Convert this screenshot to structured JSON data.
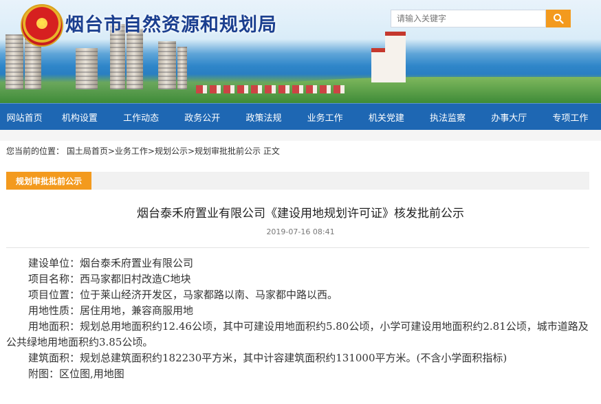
{
  "header": {
    "site_title": "烟台市自然资源和规划局",
    "search_placeholder": "请输入关键字",
    "emblem_icon": "national-emblem-icon",
    "search_icon": "search-icon",
    "accent_color": "#f39a1e",
    "nav_color": "#1e67b3"
  },
  "nav": {
    "items": [
      "网站首页",
      "机构设置",
      "工作动态",
      "政务公开",
      "政策法规",
      "业务工作",
      "机关党建",
      "执法监察",
      "办事大厅",
      "专项工作"
    ]
  },
  "breadcrumb": {
    "prefix": "您当前的位置：",
    "path": "国土局首页>业务工作>规划公示>规划审批批前公示   正文"
  },
  "section": {
    "label": "规划审批批前公示"
  },
  "article": {
    "title": "烟台泰禾府置业有限公司《建设用地规划许可证》核发批前公示",
    "date": "2019-07-16 08:41",
    "paragraphs": [
      "建设单位：烟台泰禾府置业有限公司",
      "项目名称：西马家都旧村改造C地块",
      "项目位置：位于莱山经济开发区，马家都路以南、马家都中路以西。",
      "用地性质：居住用地，兼容商服用地",
      "用地面积：规划总用地面积约12.46公顷，其中可建设用地面积约5.80公顷，小学可建设用地面积约2.81公顷，城市道路及公共绿地用地面积约3.85公顷。",
      "建筑面积：规划总建筑面积约182230平方米，其中计容建筑面积约131000平方米。(不含小学面积指标)",
      "附图：区位图,用地图"
    ]
  }
}
